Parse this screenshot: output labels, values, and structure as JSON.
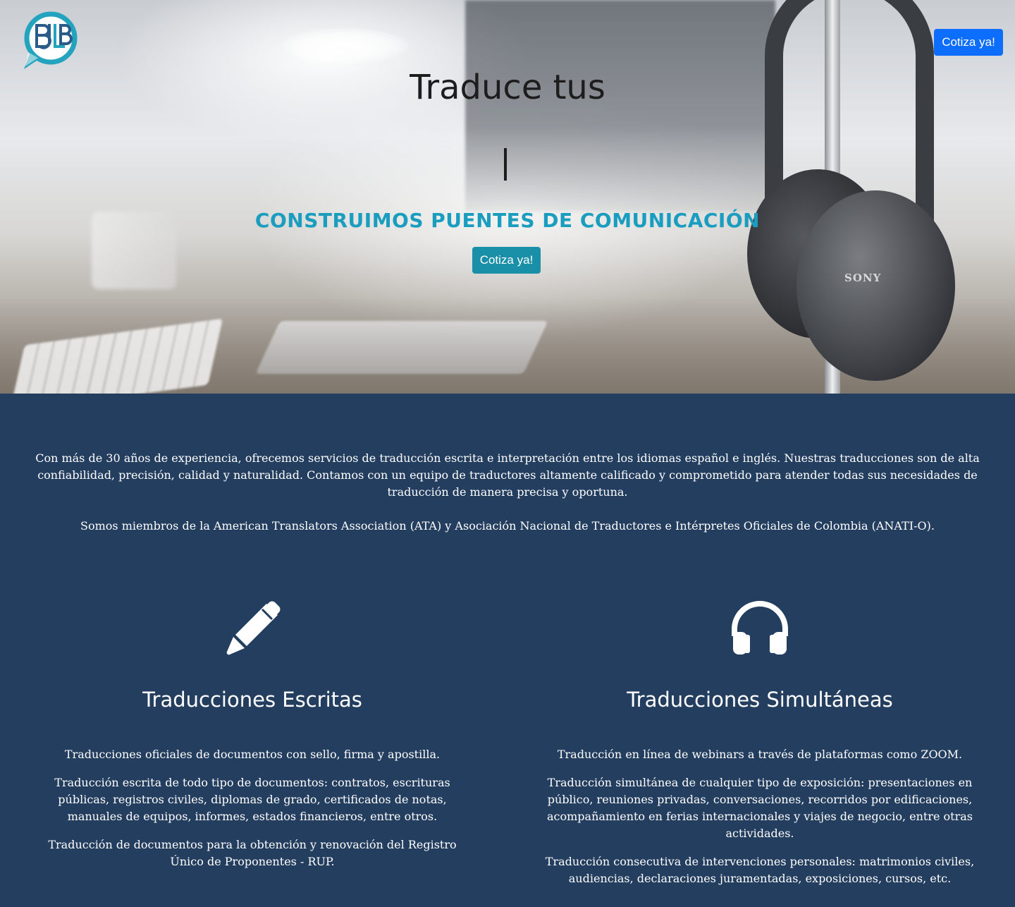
{
  "header": {
    "logo_text": "BJLB",
    "cta_label": "Cotiza ya!"
  },
  "hero": {
    "title": "Traduce tus",
    "subtitle": "CONSTRUIMOS PUENTES DE COMUNICACIÓN",
    "cta_label": "Cotiza ya!",
    "background_brand": "SONY"
  },
  "about": {
    "paragraphs": [
      "Con más de 30 años de experiencia, ofrecemos servicios de traducción escrita e interpretación entre los idiomas español e inglés. Nuestras traducciones son de alta confiabilidad, precisión, calidad y naturalidad. Contamos con un equipo de traductores altamente calificado y comprometido para atender todas sus necesidades de traducción de manera precisa y oportuna.",
      "Somos miembros de la American Translators Association (ATA) y Asociación Nacional de Traductores e Intérpretes Oficiales de Colombia (ANATI-O)."
    ]
  },
  "services": [
    {
      "icon": "pencil-icon",
      "title": "Traducciones Escritas",
      "items": [
        "Traducciones oficiales de documentos con sello, firma y apostilla.",
        "Traducción escrita de todo tipo de documentos: contratos, escrituras públicas, registros civiles, diplomas de grado, certificados de notas, manuales de equipos, informes, estados financieros, entre otros.",
        "Traducción de documentos para la obtención y renovación del Registro Único de Proponentes - RUP."
      ]
    },
    {
      "icon": "headphones-icon",
      "title": "Traducciones Simultáneas",
      "items": [
        "Traducción en línea de webinars a través de plataformas como ZOOM.",
        "Traducción simultánea de cualquier tipo de exposición: presentaciones en público, reuniones privadas, conversaciones, recorridos por edificaciones, acompañamiento en ferias internacionales y viajes de negocio, entre otras actividades.",
        "Traducción consecutiva de intervenciones personales: matrimonios civiles, audiencias, declaraciones juramentadas, exposiciones, cursos, etc."
      ]
    }
  ],
  "colors": {
    "section_bg": "#243e60",
    "accent": "#1a9dbf",
    "primary_button": "#0d6efd",
    "hero_button": "#1990a8"
  }
}
